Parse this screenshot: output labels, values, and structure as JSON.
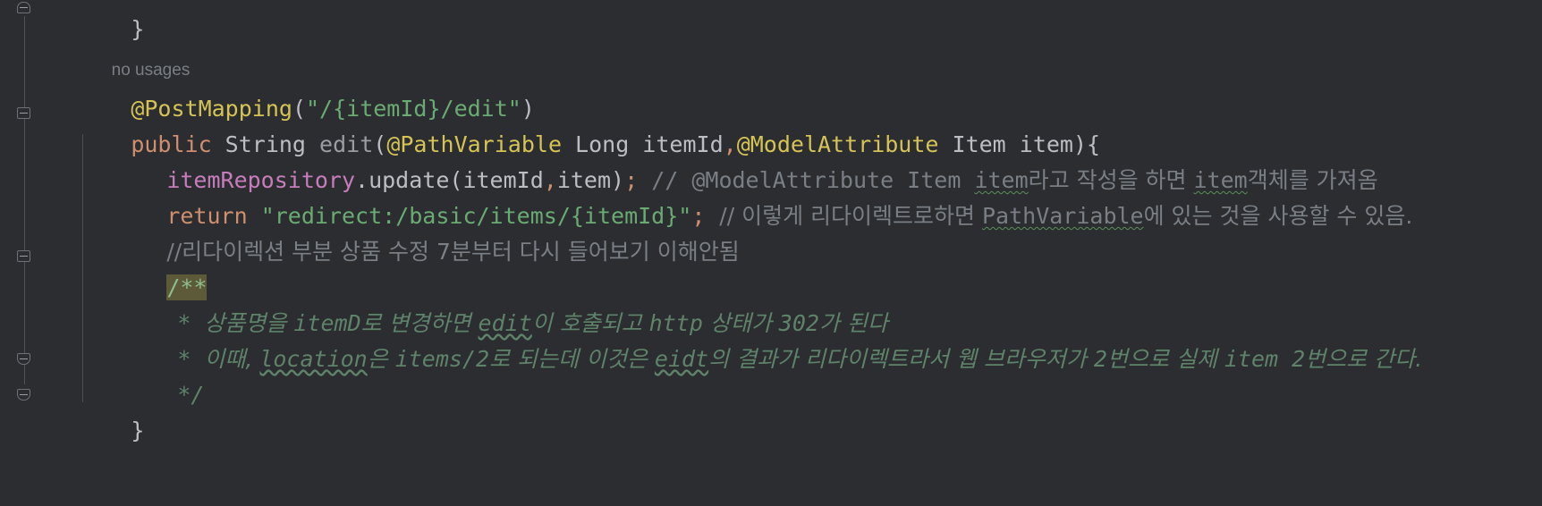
{
  "editor": {
    "theme_background": "#2b2d30",
    "default_text_color": "#bcbec4",
    "gutter": {
      "fold_markers": [
        "collapse",
        "collapse",
        "collapse",
        "collapse",
        "collapse"
      ]
    },
    "inlay_hint": "no usages",
    "lines": [
      {
        "id": "line-close-brace-prev",
        "tokens": [
          {
            "t": "}",
            "c": "punct"
          }
        ]
      },
      {
        "id": "line-post-mapping",
        "tokens": [
          {
            "t": "@PostMapping",
            "c": "annot"
          },
          {
            "t": "(",
            "c": "punct"
          },
          {
            "t": "\"/{itemId}/edit\"",
            "c": "str"
          },
          {
            "t": ")",
            "c": "punct"
          }
        ]
      },
      {
        "id": "line-method-signature",
        "tokens": [
          {
            "t": "public",
            "c": "kw"
          },
          {
            "t": " String ",
            "c": "type"
          },
          {
            "t": "edit",
            "c": "methoddim"
          },
          {
            "t": "(",
            "c": "punct"
          },
          {
            "t": "@PathVariable",
            "c": "annot"
          },
          {
            "t": " Long itemId",
            "c": "type"
          },
          {
            "t": ",",
            "c": "semi"
          },
          {
            "t": "@ModelAttribute",
            "c": "annot"
          },
          {
            "t": " Item item",
            "c": "type"
          },
          {
            "t": ")",
            "c": "punct"
          },
          {
            "t": "{",
            "c": "punct"
          }
        ]
      },
      {
        "id": "line-update-call",
        "tokens": [
          {
            "t": "itemRepository",
            "c": "field"
          },
          {
            "t": ".update(itemId",
            "c": "punct"
          },
          {
            "t": ",",
            "c": "semi"
          },
          {
            "t": "item)",
            "c": "punct"
          },
          {
            "t": ";",
            "c": "semi"
          },
          {
            "t": " // @ModelAttribute Item ",
            "c": "comment"
          },
          {
            "t": "item",
            "c": "comment-squiggle"
          },
          {
            "t": "라고 작성을 하면 ",
            "c": "comment"
          },
          {
            "t": "item",
            "c": "comment-squiggle"
          },
          {
            "t": "객체를 가져옴",
            "c": "comment"
          }
        ]
      },
      {
        "id": "line-return-redirect",
        "tokens": [
          {
            "t": "return",
            "c": "kw"
          },
          {
            "t": " ",
            "c": "punct"
          },
          {
            "t": "\"redirect:/basic/items/{itemId}\"",
            "c": "str"
          },
          {
            "t": ";",
            "c": "semi"
          },
          {
            "t": "  // 이렇게 리다이렉트로하면 ",
            "c": "comment"
          },
          {
            "t": "PathVariable",
            "c": "comment-squiggle"
          },
          {
            "t": "에 있는 것을 사용할 수 있음.",
            "c": "comment"
          }
        ]
      },
      {
        "id": "line-note-comment",
        "tokens": [
          {
            "t": "//리다이렉션 부분 상품 수정 7분부터 다시 들어보기 이해안됨",
            "c": "comment"
          }
        ]
      },
      {
        "id": "line-javadoc-open",
        "tokens": [
          {
            "t": "/**",
            "c": "doc-highlighted"
          }
        ]
      },
      {
        "id": "line-javadoc-1",
        "prefix": "* ",
        "tokens": [
          {
            "t": "상품명을 ",
            "c": "doc"
          },
          {
            "t": "itemD",
            "c": "doc-mono"
          },
          {
            "t": "로 변경하면 ",
            "c": "doc"
          },
          {
            "t": "edit",
            "c": "doc-mono-squiggle"
          },
          {
            "t": "이 호출되고 ",
            "c": "doc"
          },
          {
            "t": "http",
            "c": "doc-mono"
          },
          {
            "t": " 상태가 ",
            "c": "doc"
          },
          {
            "t": "302",
            "c": "doc-mono"
          },
          {
            "t": "가 된다",
            "c": "doc"
          }
        ]
      },
      {
        "id": "line-javadoc-2",
        "prefix": "* ",
        "tokens": [
          {
            "t": "이때, ",
            "c": "doc"
          },
          {
            "t": "location",
            "c": "doc-mono-squiggle"
          },
          {
            "t": "은 ",
            "c": "doc"
          },
          {
            "t": "items/2",
            "c": "doc-mono"
          },
          {
            "t": "로 되는데 이것은 ",
            "c": "doc"
          },
          {
            "t": "eidt",
            "c": "doc-mono-squiggle"
          },
          {
            "t": "의 결과가 리다이렉트라서 웹 브라우저가 ",
            "c": "doc"
          },
          {
            "t": "2",
            "c": "doc-mono"
          },
          {
            "t": "번으로 실제 ",
            "c": "doc"
          },
          {
            "t": "item",
            "c": "doc-mono"
          },
          {
            "t": " 2",
            "c": "doc-mono"
          },
          {
            "t": "번으로 간다.",
            "c": "doc"
          }
        ]
      },
      {
        "id": "line-javadoc-close",
        "tokens": [
          {
            "t": "*/",
            "c": "doc"
          }
        ]
      },
      {
        "id": "line-close-brace",
        "tokens": [
          {
            "t": "}",
            "c": "punct"
          }
        ]
      }
    ],
    "text": {
      "l0": "}",
      "hint": "no usages",
      "l1_annot": "@PostMapping",
      "l1_open": "(",
      "l1_str": "\"/{itemId}/edit\"",
      "l1_close": ")",
      "l2_public": "public",
      "l2_string": " String ",
      "l2_edit": "edit",
      "l2_paren": "(",
      "l2_pathvar": "@PathVariable",
      "l2_long": " Long itemId",
      "l2_comma": ",",
      "l2_modelattr": "@ModelAttribute",
      "l2_item": " Item item",
      "l2_rparen": ")",
      "l2_brace": "{",
      "l3_repo": "itemRepository",
      "l3_update": ".update(itemId",
      "l3_comma": ",",
      "l3_itemclose": "item)",
      "l3_semi": ";",
      "l3_c1": " // @ModelAttribute Item ",
      "l3_c2": "item",
      "l3_c3": "라고 작성을 하면 ",
      "l3_c4": "item",
      "l3_c5": "객체를 가져옴",
      "l4_return": "return",
      "l4_sp": " ",
      "l4_str": "\"redirect:/basic/items/{itemId}\"",
      "l4_semi": ";",
      "l4_c1": "  // 이렇게 리다이렉트로하면 ",
      "l4_c2": "PathVariable",
      "l4_c3": "에 있는 것을 사용할 수 있음.",
      "l5_comment": "//리다이렉션 부분 상품 수정 7분부터 다시 들어보기 이해안됨",
      "l6_doc": "/**",
      "l7_star": "* ",
      "l7_a": "상품명을 ",
      "l7_b": "itemD",
      "l7_c": "로 변경하면 ",
      "l7_d": "edit",
      "l7_e": "이 호출되고 ",
      "l7_f": "http",
      "l7_g": " 상태가 ",
      "l7_h": "302",
      "l7_i": "가 된다",
      "l8_star": "* ",
      "l8_a": "이때, ",
      "l8_b": "location",
      "l8_c": "은 ",
      "l8_d": "items/2",
      "l8_e": "로 되는데 이것은 ",
      "l8_f": "eidt",
      "l8_g": "의 결과가 리다이렉트라서 웹 브라우저가 ",
      "l8_h": "2",
      "l8_i": "번으로 실제 ",
      "l8_j": "item",
      "l8_k": " 2",
      "l8_l": "번으로 간다.",
      "l9_doc": "*/",
      "l10_brace": "}"
    },
    "colors": {
      "background": "#2b2d30",
      "foreground": "#bcbec4",
      "keyword": "#cf8e6d",
      "annotation": "#d5c455",
      "string": "#6aab73",
      "field": "#c77dbb",
      "comment": "#7a7e85",
      "javadoc": "#5f826b",
      "highlight": "#5c5a38",
      "typo_squiggle": "#5a8f5a"
    }
  }
}
